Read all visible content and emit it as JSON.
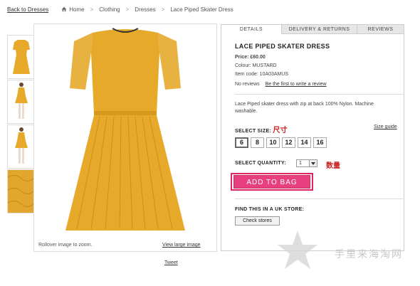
{
  "breadcrumb": {
    "back": "Back to Dresses",
    "items": [
      "Home",
      "Clothing",
      "Dresses",
      "Lace Piped Skater Dress"
    ]
  },
  "image": {
    "rollover": "Rollover image to zoom.",
    "view_large": "View large image",
    "tweet": "Tweet"
  },
  "tabs": [
    "DETAILS",
    "DELIVERY & RETURNS",
    "REVIEWS"
  ],
  "product": {
    "title": "LACE PIPED SKATER DRESS",
    "price": "Price: £60.00",
    "colour": "Colour: MUSTARD",
    "item_code": "Item code: 10A03AMUS",
    "no_reviews": "No reviews",
    "write_review": "Be the first to write a review",
    "description": "Lace Piped skater dress with zip at back 100% Nylon. Machine washable."
  },
  "size": {
    "label": "SELECT SIZE:",
    "annotation": "尺寸",
    "guide": "Size guide",
    "options": [
      "6",
      "8",
      "10",
      "12",
      "14",
      "16"
    ],
    "selected": "6"
  },
  "quantity": {
    "label": "SELECT QUANTITY:",
    "value": "1",
    "annotation": "数量"
  },
  "add_to_bag": "ADD TO BAG",
  "store": {
    "label": "FIND THIS IN A UK STORE:",
    "button": "Check stores"
  },
  "watermark": "手里来海淘网",
  "colors": {
    "dress": "#e6a92a",
    "bag_button": "#e8407f",
    "annotation": "#cc2020"
  }
}
